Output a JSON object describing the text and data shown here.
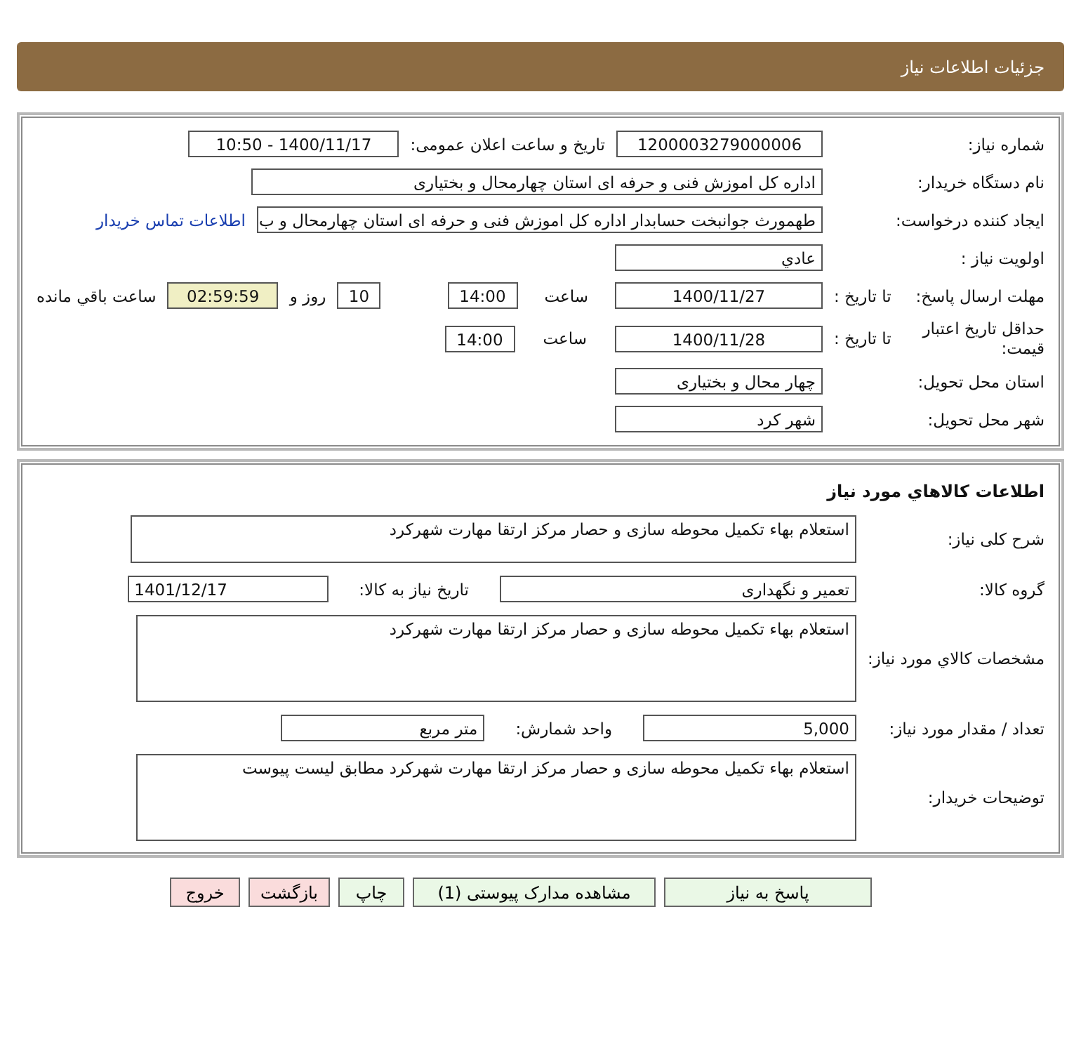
{
  "header": {
    "title": "جزئیات اطلاعات نیاز"
  },
  "summary": {
    "need_number": {
      "label": "شماره نیاز:",
      "value": "1200003279000006"
    },
    "announce": {
      "label": "تاریخ و ساعت اعلان عمومی:",
      "value": "1400/11/17 - 10:50"
    },
    "buyer": {
      "label": "نام دستگاه خریدار:",
      "value": "اداره کل اموزش فنی و حرفه ای استان چهارمحال و بختیاری"
    },
    "creator": {
      "label": "ایجاد کننده درخواست:",
      "value": "طهمورث جوانبخت حسابدار اداره کل اموزش فنی و حرفه ای استان چهارمحال و ب",
      "link": "اطلاعات تماس خریدار"
    },
    "priority": {
      "label": "اولویت نیاز :",
      "value": "عادي"
    },
    "deadline": {
      "label": "مهلت ارسال پاسخ:",
      "sublabel": "تا تاریخ :",
      "date": "1400/11/27",
      "time_label": "ساعت",
      "time": "14:00",
      "days": "10",
      "days_label": "روز و",
      "remaining": "02:59:59",
      "remaining_label": "ساعت باقي مانده"
    },
    "validity": {
      "label": "حداقل تاریخ اعتبار قیمت:",
      "sublabel": "تا تاریخ :",
      "date": "1400/11/28",
      "time_label": "ساعت",
      "time": "14:00"
    },
    "province": {
      "label": "استان محل تحویل:",
      "value": "چهار محال و بختیاری"
    },
    "city": {
      "label": "شهر محل تحویل:",
      "value": "شهر کرد"
    }
  },
  "goods": {
    "title": "اطلاعات كالاهاي مورد نياز",
    "description": {
      "label": "شرح کلی نیاز:",
      "value": "استعلام بهاء تکمیل محوطه سازی و حصار مرکز ارتقا مهارت شهرکرد"
    },
    "group": {
      "label": "گروه کالا:",
      "value": "تعمیر و نگهداری",
      "date_label": "تاریخ نیاز به کالا:",
      "date": "1401/12/17"
    },
    "specs": {
      "label": "مشخصات کالاي مورد نياز:",
      "value": "استعلام بهاء تکمیل محوطه سازی و حصار مرکز ارتقا مهارت شهرکرد"
    },
    "quantity": {
      "label": "تعداد / مقدار مورد نیاز:",
      "value": "5,000",
      "unit_label": "واحد شمارش:",
      "unit": "متر مربع"
    },
    "notes": {
      "label": "توضیحات خریدار:",
      "value": "استعلام بهاء تکمیل محوطه سازی و حصار مرکز ارتقا مهارت شهرکرد مطابق لیست پیوست"
    }
  },
  "buttons": [
    {
      "label": "پاسخ به نیاز",
      "kind": "action"
    },
    {
      "label": "مشاهده مدارک پیوستی (1)",
      "kind": "action"
    },
    {
      "label": "چاپ",
      "kind": "action"
    },
    {
      "label": "بازگشت",
      "kind": "exit"
    },
    {
      "label": "خروج",
      "kind": "exit"
    }
  ]
}
